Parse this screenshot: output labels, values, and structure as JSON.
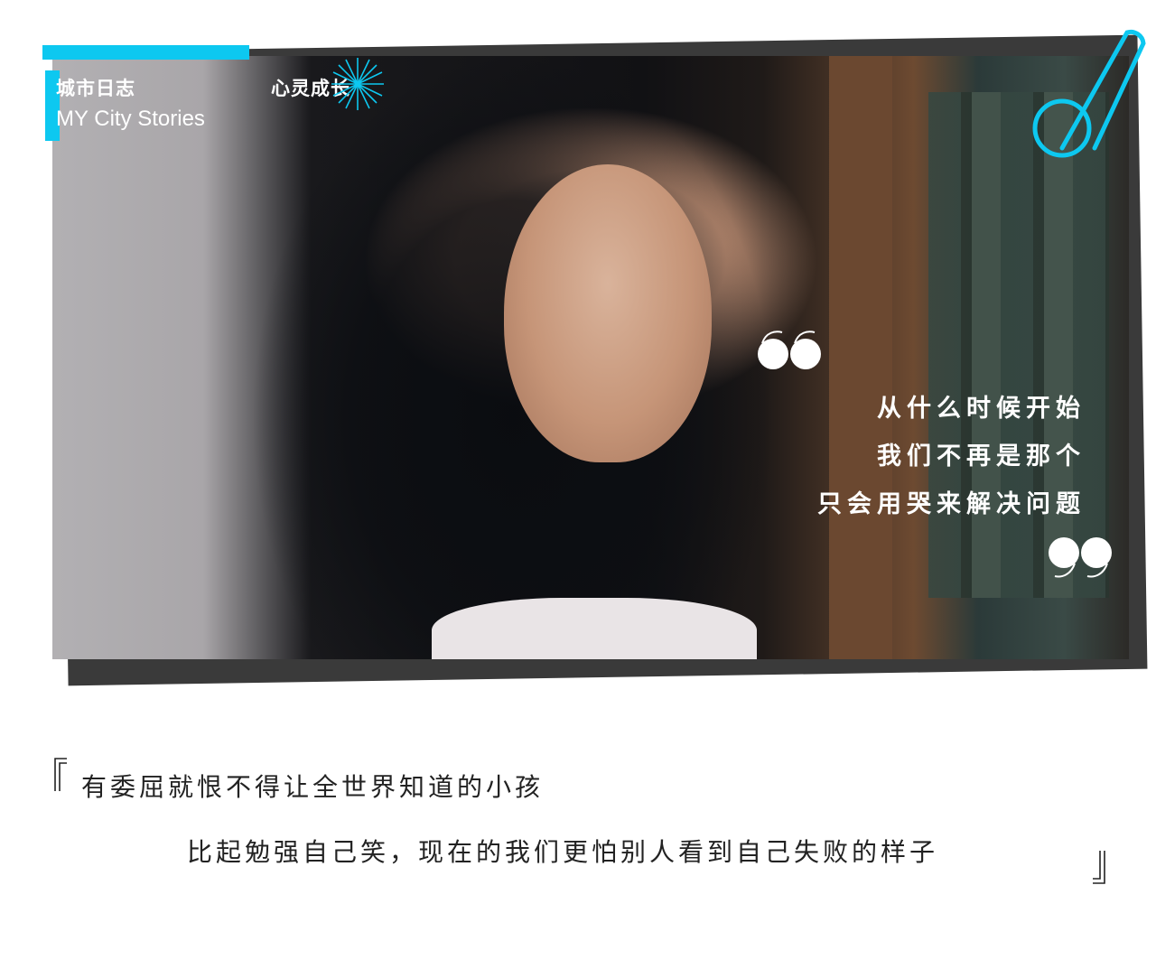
{
  "header": {
    "category_cn": "城市日志",
    "category_en": "MY City Stories",
    "tag_cn": "心灵成长"
  },
  "icons": {
    "burst": "starburst-icon",
    "paperclip": "paperclip-icon",
    "open_quote": "open-quote-icon",
    "close_quote": "close-quote-icon"
  },
  "colors": {
    "accent": "#0dc8f0",
    "frame_shadow": "#3a3a3a",
    "text_dark": "#222222"
  },
  "quote": {
    "lines": [
      "从什么时候开始",
      "我们不再是那个",
      "只会用哭来解决问题"
    ]
  },
  "bottom": {
    "line1": "有委屈就恨不得让全世界知道的小孩",
    "line2": "比起勉强自己笑，现在的我们更怕别人看到自己失败的样子"
  }
}
